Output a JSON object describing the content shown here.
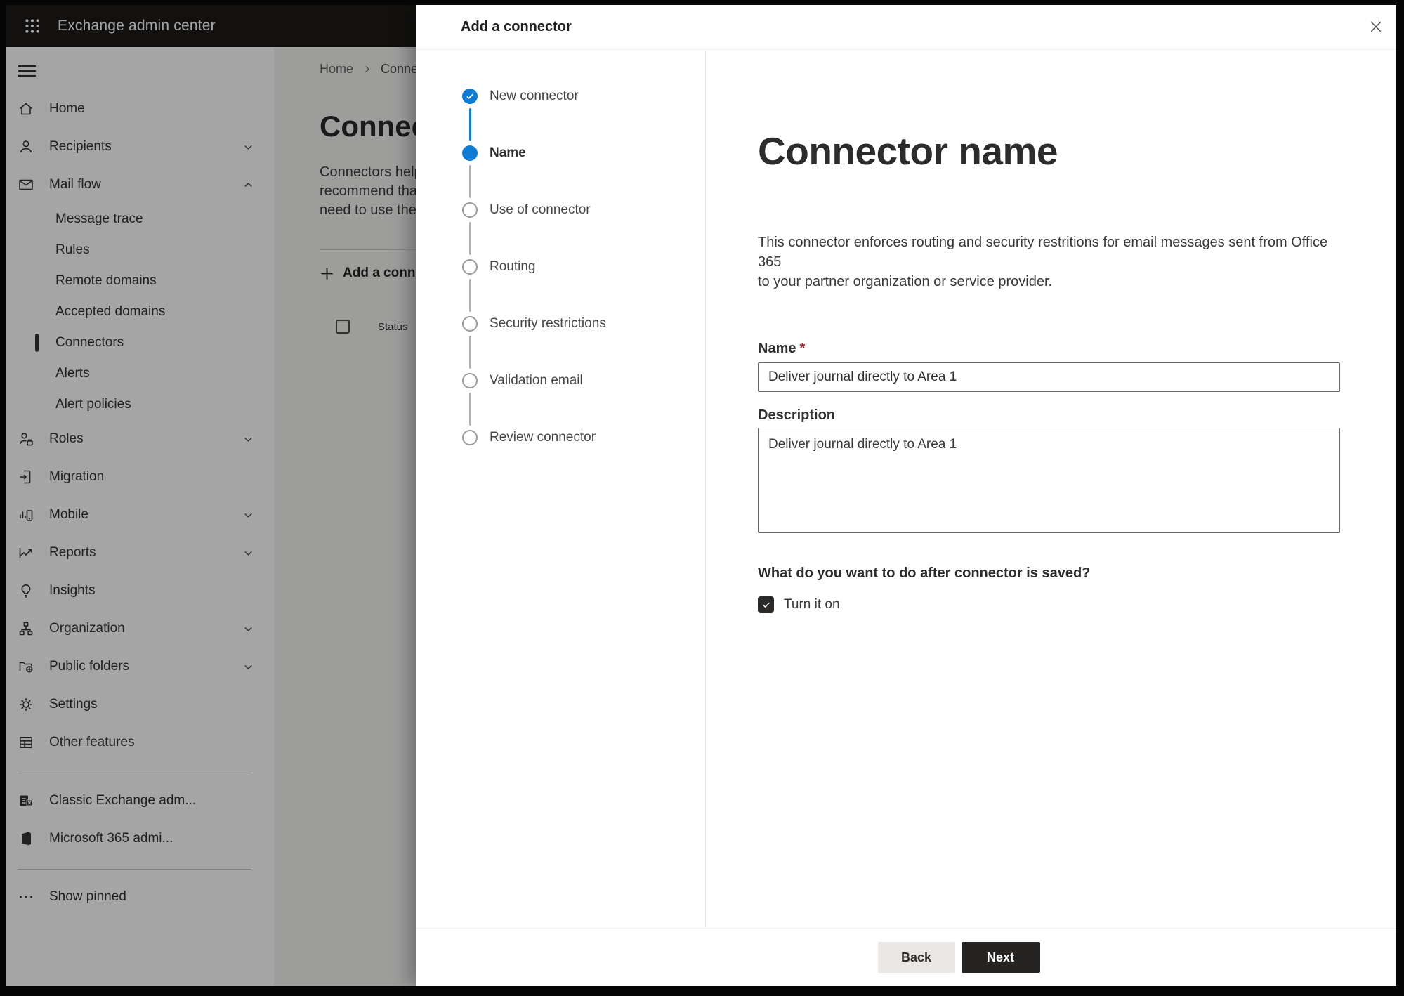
{
  "topbar": {
    "app_title": "Exchange admin center"
  },
  "sidebar": {
    "items": [
      {
        "label": "Home"
      },
      {
        "label": "Recipients",
        "expandable": true
      },
      {
        "label": "Mail flow",
        "expandable": true,
        "expanded": true
      },
      {
        "label": "Message trace"
      },
      {
        "label": "Rules"
      },
      {
        "label": "Remote domains"
      },
      {
        "label": "Accepted domains"
      },
      {
        "label": "Connectors",
        "selected": true
      },
      {
        "label": "Alerts"
      },
      {
        "label": "Alert policies"
      },
      {
        "label": "Roles",
        "expandable": true
      },
      {
        "label": "Migration"
      },
      {
        "label": "Mobile",
        "expandable": true
      },
      {
        "label": "Reports",
        "expandable": true
      },
      {
        "label": "Insights"
      },
      {
        "label": "Organization",
        "expandable": true
      },
      {
        "label": "Public folders",
        "expandable": true
      },
      {
        "label": "Settings"
      },
      {
        "label": "Other features"
      },
      {
        "label": "Classic Exchange adm..."
      },
      {
        "label": "Microsoft 365 admi..."
      },
      {
        "label": "Show pinned"
      }
    ]
  },
  "page": {
    "breadcrumb": {
      "home": "Home",
      "current": "Conne"
    },
    "title_fragment": "Connec",
    "intro_lines": {
      "line1": "Connectors help",
      "line2": "recommend that",
      "line3": "need to use ther"
    },
    "add_button_fragment": "Add a conn",
    "table": {
      "status_header": "Status"
    }
  },
  "dialog": {
    "title": "Add a connector",
    "steps": [
      {
        "label": "New connector",
        "state": "completed"
      },
      {
        "label": "Name",
        "state": "current"
      },
      {
        "label": "Use of connector",
        "state": "upcoming"
      },
      {
        "label": "Routing",
        "state": "upcoming"
      },
      {
        "label": "Security restrictions",
        "state": "upcoming"
      },
      {
        "label": "Validation email",
        "state": "upcoming"
      },
      {
        "label": "Review connector",
        "state": "upcoming"
      }
    ],
    "form": {
      "heading": "Connector name",
      "description_line1": "This connector enforces routing and security restritions for email messages sent from Office 365",
      "description_line2": "to your partner organization or service provider.",
      "name_label": "Name",
      "required_mark": "*",
      "name_value": "Deliver journal directly to Area 1",
      "description_label": "Description",
      "description_value": "Deliver journal directly to Area 1",
      "after_save_question": "What do you want to do after connector is saved?",
      "turn_on_label": "Turn it on",
      "turn_on_checked": true
    },
    "footer": {
      "back_label": "Back",
      "next_label": "Next"
    }
  },
  "colors": {
    "accent": "#0f7cd6",
    "primary_button": "#252423",
    "required": "#a4262c"
  }
}
